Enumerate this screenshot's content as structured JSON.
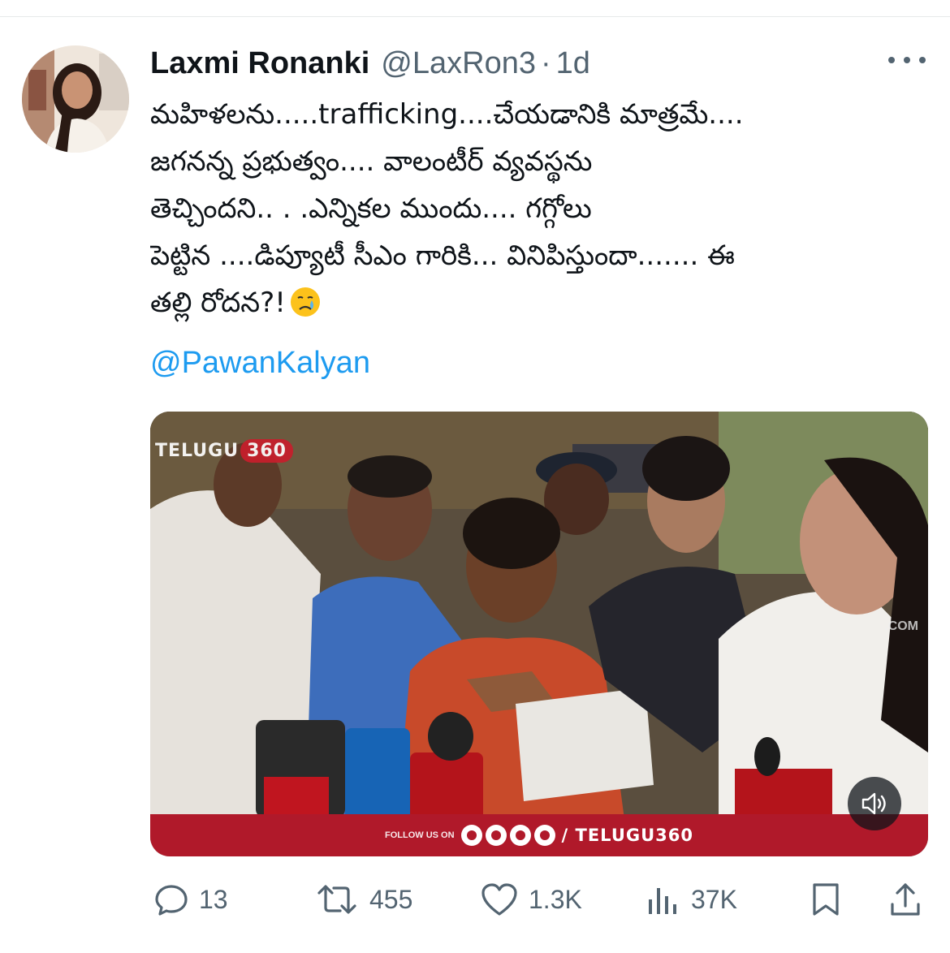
{
  "tweet": {
    "author_name": "Laxmi Ronanki",
    "handle": "@LaxRon3",
    "separator": "·",
    "time_ago": "1d",
    "text_lines": [
      "మహిళలను.....trafficking....చేయడానికి మాత్రమే....",
      "జగనన్న ప్రభుత్వం.... వాలంటీర్ వ్యవస్థను",
      "తెచ్చిందని.. . .ఎన్నికల ముందు.... గగ్గోలు",
      "పెట్టిన ....డిప్యూటీ సీఎం గారికి... వినిపిస్తుందా....... ఈ",
      "తల్లి రోదన?!"
    ],
    "mention": "@PawanKalyan"
  },
  "media": {
    "watermark_text": "TELUGU",
    "watermark_num": "360",
    "right_watermark": ".COM",
    "follow_label": "FOLLOW US ON",
    "footer_handle": "/ TELUGU360"
  },
  "actions": {
    "replies": "13",
    "reposts": "455",
    "likes": "1.3K",
    "views": "37K"
  },
  "icons": {
    "more": "more-icon",
    "reply": "reply-icon",
    "repost": "repost-icon",
    "like": "heart-icon",
    "views": "views-icon",
    "bookmark": "bookmark-icon",
    "share": "share-icon",
    "mute": "speaker-muted-icon",
    "emoji": "crying-face-emoji"
  },
  "colors": {
    "text": "#0f1419",
    "secondary": "#536471",
    "link": "#1d9bf0",
    "brand_red": "#b0192a"
  }
}
